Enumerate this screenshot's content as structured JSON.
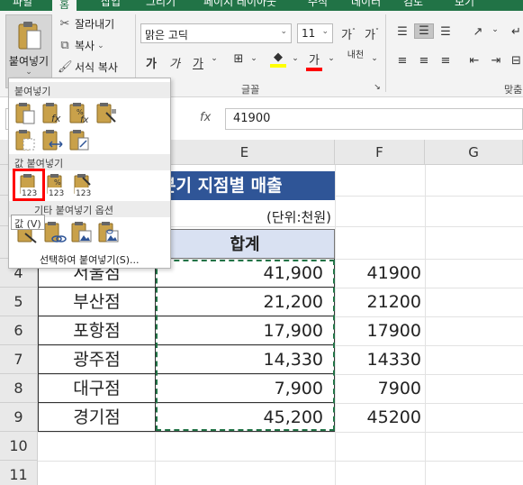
{
  "ribbon": {
    "tabs": [
      "파일",
      "홈",
      "삽입",
      "그리기",
      "페이지 레이아웃",
      "수식",
      "데이터",
      "검토",
      "보기"
    ],
    "active_tab_index": 1,
    "clipboard": {
      "paste_label": "붙여넣기",
      "cut_label": "잘라내기",
      "copy_label": "복사",
      "format_painter_label": "서식 복사"
    },
    "font": {
      "font_name": "맑은 고딕",
      "font_size": "11",
      "group_label": "글꼴",
      "phonetic_label": "내천"
    },
    "alignment_group_label": "맞춤"
  },
  "formula_bar": {
    "fx_label": "fx",
    "value": "41900"
  },
  "paste_menu": {
    "section_paste": "붙여넣기",
    "section_paste_values": "값 붙여넣기",
    "section_other": "기타 붙여넣기 옵션",
    "paste_special_label": "선택하여 붙여넣기(S)...",
    "tooltip": "값 (V)"
  },
  "sheet": {
    "columns": [
      "E",
      "F",
      "G"
    ],
    "rows": [
      "4",
      "5",
      "6",
      "7",
      "8",
      "9",
      "10",
      "11"
    ],
    "title": "분기 지점별 매출",
    "unit": "(단위:천원)",
    "total_header": "합계",
    "data": [
      {
        "name": "서울점",
        "total": "41,900",
        "value": "41900"
      },
      {
        "name": "부산점",
        "total": "21,200",
        "value": "21200"
      },
      {
        "name": "포항점",
        "total": "17,900",
        "value": "17900"
      },
      {
        "name": "광주점",
        "total": "14,330",
        "value": "14330"
      },
      {
        "name": "대구점",
        "total": "7,900",
        "value": "7900"
      },
      {
        "name": "경기점",
        "total": "45,200",
        "value": "45200"
      }
    ]
  },
  "colors": {
    "ribbon_green": "#217346",
    "title_fill": "#2f5597",
    "header_fill": "#d9e1f2",
    "selection_red": "#ff0000",
    "marquee_green": "#217346"
  }
}
